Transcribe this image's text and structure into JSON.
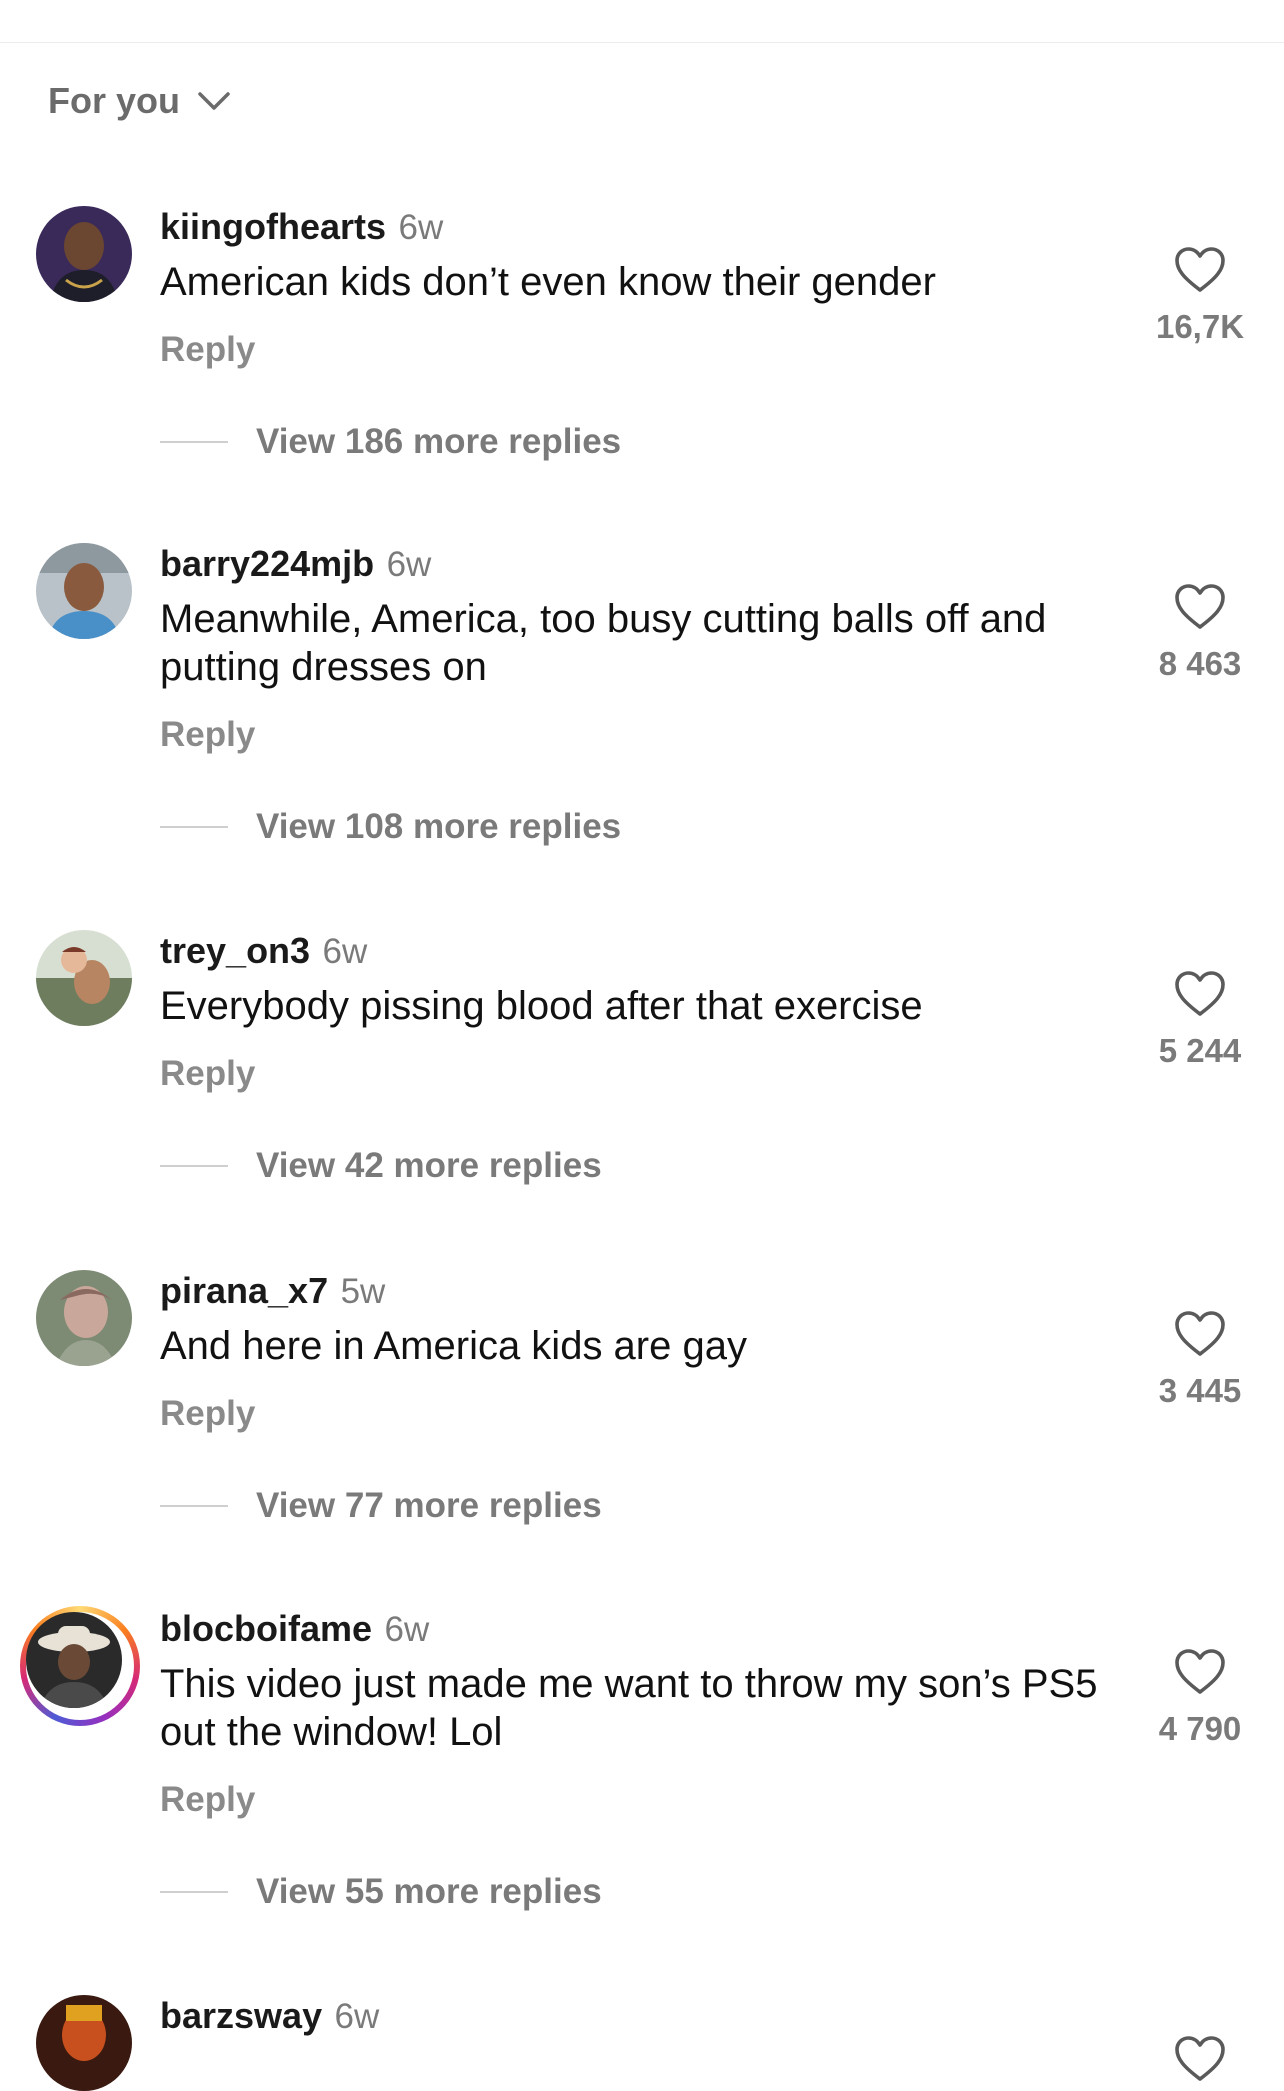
{
  "filter": {
    "label": "For you"
  },
  "comments": [
    {
      "username": "kiingofhearts",
      "time": "6w",
      "text": "American kids don’t even know their gender",
      "reply_label": "Reply",
      "likes": "16,7K",
      "view_replies": "View 186 more replies"
    },
    {
      "username": "barry224mjb",
      "time": "6w",
      "text": "Meanwhile, America, too busy cutting balls off and putting dresses on",
      "reply_label": "Reply",
      "likes": "8 463",
      "view_replies": "View 108 more replies"
    },
    {
      "username": "trey_on3",
      "time": "6w",
      "text": "Everybody pissing blood after that exercise",
      "reply_label": "Reply",
      "likes": "5 244",
      "view_replies": "View 42 more replies"
    },
    {
      "username": "pirana_x7",
      "time": "5w",
      "text": "And here in America kids are gay",
      "reply_label": "Reply",
      "likes": "3 445",
      "view_replies": "View 77 more replies"
    },
    {
      "username": "blocboifame",
      "time": "6w",
      "text": "This video just made me want to throw my son’s PS5 out the window! Lol",
      "reply_label": "Reply",
      "likes": "4 790",
      "view_replies": "View 55 more replies"
    },
    {
      "username": "barzsway",
      "time": "6w"
    }
  ],
  "colors": {
    "muted_text": "#7a7a7a",
    "primary_text": "#111111",
    "story_ring": [
      "#feda75",
      "#fa7e1e",
      "#d62976",
      "#962fbf",
      "#4f5bd5"
    ]
  },
  "icons": {
    "like": "heart-outline-icon",
    "filter": "chevron-down-icon"
  }
}
